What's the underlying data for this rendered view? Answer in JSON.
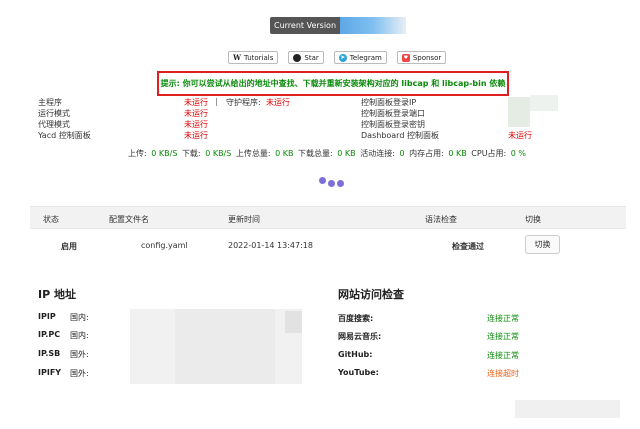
{
  "version": {
    "label": "Current Version"
  },
  "links": [
    {
      "icon": "wikipedia-icon",
      "glyph": "W",
      "label": "Tutorials"
    },
    {
      "icon": "github-icon",
      "glyph": "●",
      "label": "Star"
    },
    {
      "icon": "telegram-icon",
      "glyph": "➤",
      "label": "Telegram"
    },
    {
      "icon": "sponsor-icon",
      "glyph": "♥",
      "label": "Sponsor"
    }
  ],
  "hint": "提示: 你可以尝试从给出的地址中查找、下载并重新安装架构对应的 libcap 和 libcap-bin 依赖",
  "status": {
    "main_program": {
      "label": "主程序",
      "value": "未运行",
      "sep": "|",
      "guard_label": "守护程序:",
      "guard_value": "未运行"
    },
    "run_mode": {
      "label": "运行模式",
      "value": "未运行"
    },
    "proxy_mode": {
      "label": "代理模式",
      "value": "未运行"
    },
    "yacd": {
      "label": "Yacd 控制面板",
      "value": "未运行"
    },
    "login_ip": {
      "label": "控制面板登录IP"
    },
    "login_port": {
      "label": "控制面板登录端口"
    },
    "login_key": {
      "label": "控制面板登录密钥"
    },
    "dashboard": {
      "label": "Dashboard 控制面板",
      "value": "未运行"
    }
  },
  "traffic": {
    "upload_label": "上传:",
    "upload": "0 KB/S",
    "download_label": "下载:",
    "download": "0 KB/S",
    "upload_total_label": "上传总量:",
    "upload_total": "0 KB",
    "download_total_label": "下载总量:",
    "download_total": "0 KB",
    "conn_label": "活动连接:",
    "conn": "0",
    "mem_label": "内存占用:",
    "mem": "0 KB",
    "cpu_label": "CPU占用:",
    "cpu": "0 %"
  },
  "config_table": {
    "headers": {
      "status": "状态",
      "filename": "配置文件名",
      "updated": "更新时间",
      "syntax": "语法检查",
      "switch": "切换"
    },
    "row": {
      "status": "启用",
      "filename": "config.yaml",
      "updated": "2022-01-14 13:47:18",
      "syntax": "检查通过",
      "switch": "切换"
    }
  },
  "ip_section": {
    "title": "IP 地址",
    "rows": [
      {
        "label": "IPIP",
        "loc": "国内:"
      },
      {
        "label": "IP.PC",
        "loc": "国内:"
      },
      {
        "label": "IP.SB",
        "loc": "国外:"
      },
      {
        "label": "IPIFY",
        "loc": "国外:"
      }
    ]
  },
  "net_section": {
    "title": "网站访问检查",
    "rows": [
      {
        "label": "百度搜索:",
        "status": "连接正常",
        "ok": true
      },
      {
        "label": "网易云音乐:",
        "status": "连接正常",
        "ok": true
      },
      {
        "label": "GitHub:",
        "status": "连接正常",
        "ok": true
      },
      {
        "label": "YouTube:",
        "status": "连接超时",
        "ok": false
      }
    ]
  },
  "colors": {
    "ok": "#0a8a0a",
    "error": "#e00000",
    "timeout": "#e8621a",
    "accent": "#7c6fd6"
  }
}
